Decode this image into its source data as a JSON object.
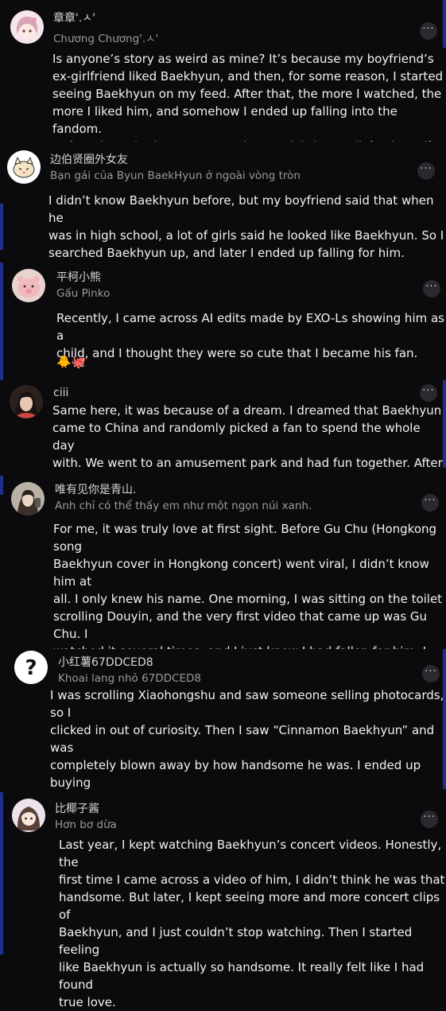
{
  "colors": {
    "background": "#0b0b0d",
    "accent": "#1e2f8e",
    "text": "#f2f2f2",
    "muted": "#9a9a9a"
  },
  "more_icon": "more-horizontal-icon",
  "comments": [
    {
      "name_original": "章章'.ㅅ'",
      "name_translated": "Chương Chương'.ㅅ'",
      "avatar": "anime-girl-pink-avatar",
      "text": "Is anyone’s story as weird as mine? It’s because my boyfriend’s\nex-girlfriend liked Baekhyun, and then, for some reason, I started\nseeing Baekhyun on my feed. After that, the more I watched, the\nmore I liked him, and somehow I ended up falling into the fandom.\nBefore that, I had never stanned any celebrity at all. [awkward]"
    },
    {
      "name_original": "边伯贤圈外女友",
      "name_translated": "Bạn gái của Byun BaekHyun ở ngoài vòng tròn",
      "avatar": "cat-sticker-avatar",
      "text": "I didn’t know Baekhyun before, but my boyfriend said that when he\nwas in high school, a lot of girls said he looked like Baekhyun. So I\nsearched Baekhyun up, and later I ended up falling for him."
    },
    {
      "name_original": "平柯小熊",
      "name_translated": "Gấu Pinko",
      "avatar": "pink-bear-avatar",
      "text": "Recently, I came across AI edits made by EXO-Ls showing him as a\nchild, and I thought they were so cute that I became his fan.",
      "emojis": "🐥🐙"
    },
    {
      "name_original": "ciii",
      "name_translated": "",
      "avatar": "girl-portrait-avatar",
      "text": "Same here, it was because of a dream. I dreamed that Baekhyun\ncame to China and randomly picked a fan to spend the whole day\nwith. We went to an amusement park and had fun together. After I\nwoke up, I fell straight into the fandom."
    },
    {
      "name_original": "唯有见你是青山.",
      "name_translated": "Anh chỉ có thể thấy em như một ngọn núi xanh.",
      "avatar": "girl-selfie-avatar",
      "text": "For me, it was truly love at first sight. Before Gu Chu (Hongkong song\nBaekhyun cover in Hongkong concert) went viral, I didn’t know him at\nall. I only knew his name. One morning, I was sitting on the toilet\nscrolling Douyin, and the very first video that came up was Gu Chu. I\nwatched it several times, and I just knew I had fallen for him. I even\nonly started recognizing his face later, when I began catching up on\nhis content."
    },
    {
      "name_original": "小红薯67DDCED8",
      "name_translated": "Khoai lang nhỏ 67DDCED8",
      "avatar": "question-mark-avatar",
      "text": "I was scrolling Xiaohongshu and saw someone selling photocards, so I\nclicked in out of curiosity. Then I saw “Cinnamon Baekhyun” and was\ncompletely blown away by how handsome he was. I ended up buying\ntwo cards and catching up on a lot of his past stages. And it just so\nhappened that oppa sang a Chinese song in Macau around that time\ntoo. I was so happy I could faint…"
    },
    {
      "name_original": "比椰子酱",
      "name_translated": "Hơn bơ dừa",
      "avatar": "anime-girl-avatar",
      "text": "Last year, I kept watching Baekhyun’s concert videos. Honestly, the\nfirst time I came across a video of him, I didn’t think he was that\nhandsome. But later, I kept seeing more and more concert clips of\nBaekhyun, and I just couldn’t stop watching. Then I started feeling\nlike Baekhyun is actually so handsome. It really felt like I had found\ntrue love."
    }
  ]
}
